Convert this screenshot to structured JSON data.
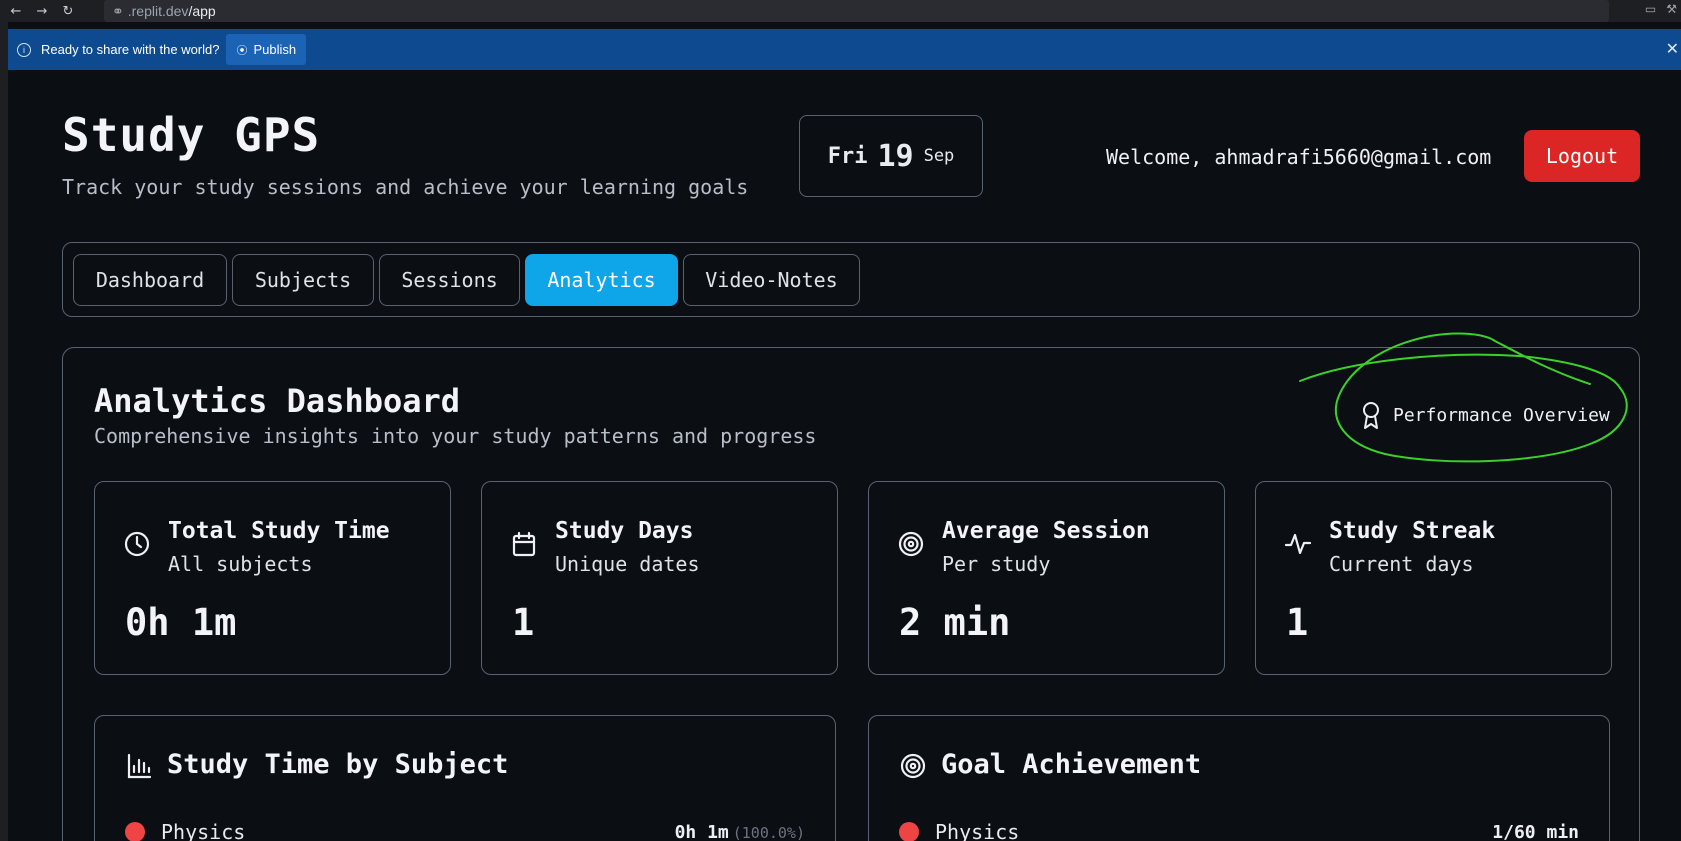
{
  "browser": {
    "url_host": ".replit.dev",
    "url_path": "/app"
  },
  "banner": {
    "message": "Ready to share with the world?",
    "publish_label": "Publish"
  },
  "header": {
    "title": "Study GPS",
    "subtitle": "Track your study sessions and achieve your learning goals",
    "date": {
      "day": "Fri",
      "num": "19",
      "month": "Sep"
    },
    "welcome": "Welcome, ahmadrafi5660@gmail.com",
    "logout_label": "Logout"
  },
  "tabs": [
    {
      "label": "Dashboard",
      "active": false
    },
    {
      "label": "Subjects",
      "active": false
    },
    {
      "label": "Sessions",
      "active": false
    },
    {
      "label": "Analytics",
      "active": true
    },
    {
      "label": "Video-Notes",
      "active": false
    }
  ],
  "analytics": {
    "title": "Analytics Dashboard",
    "subtitle": "Comprehensive insights into your study patterns and progress",
    "performance_label": "Performance Overview",
    "stats": [
      {
        "icon": "clock-icon",
        "title": "Total Study Time",
        "sub": "All subjects",
        "value": "0h 1m"
      },
      {
        "icon": "calendar-icon",
        "title": "Study Days",
        "sub": "Unique dates",
        "value": "1"
      },
      {
        "icon": "target-icon",
        "title": "Average Session",
        "sub": "Per study",
        "value": "2 min"
      },
      {
        "icon": "activity-icon",
        "title": "Study Streak",
        "sub": "Current days",
        "value": "1"
      }
    ],
    "time_by_subject": {
      "title": "Study Time by Subject",
      "rows": [
        {
          "name": "Physics",
          "time": "0h 1m",
          "pct": "(100.0%)",
          "color": "#ef4444"
        }
      ]
    },
    "goal_achievement": {
      "title": "Goal Achievement",
      "rows": [
        {
          "name": "Physics",
          "progress": "1/60 min",
          "color": "#ef4444"
        }
      ]
    }
  },
  "colors": {
    "accent": "#0ea5e9",
    "danger": "#dc2626",
    "banner": "#0d4a8f",
    "annotation": "#3bd12a"
  }
}
